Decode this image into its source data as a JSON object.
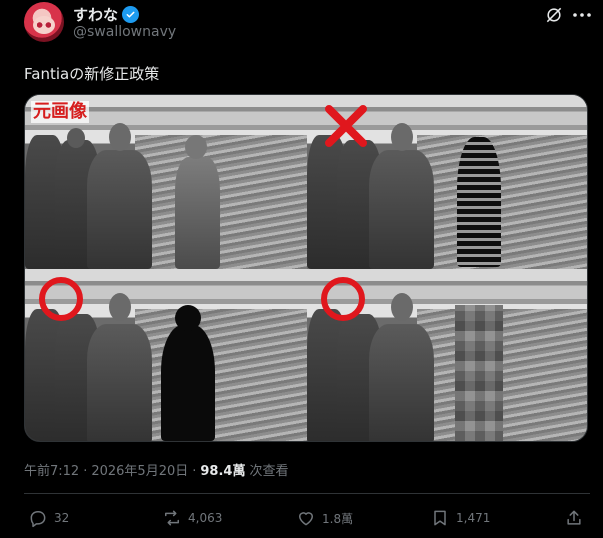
{
  "author": {
    "display_name": "すわな",
    "handle": "@swallownavy",
    "verified": true
  },
  "post": {
    "text": "Fantiaの新修正政策"
  },
  "media": {
    "original_label": "元画像"
  },
  "meta": {
    "time": "午前7:12",
    "date": "2026年5月20日",
    "views_count": "98.4萬",
    "views_label": "次查看"
  },
  "actions": {
    "replies": "32",
    "reposts": "4,063",
    "likes": "1.8萬",
    "bookmarks": "1,471"
  },
  "icons": [
    "grok-icon",
    "more-icon",
    "verified-icon",
    "reply-icon",
    "repost-icon",
    "like-icon",
    "bookmark-icon",
    "share-icon"
  ],
  "colors": {
    "background": "#000000",
    "text": "#e7e9ea",
    "muted": "#71767b",
    "verified": "#1d9bf0",
    "annotation_red": "#e0171d"
  }
}
